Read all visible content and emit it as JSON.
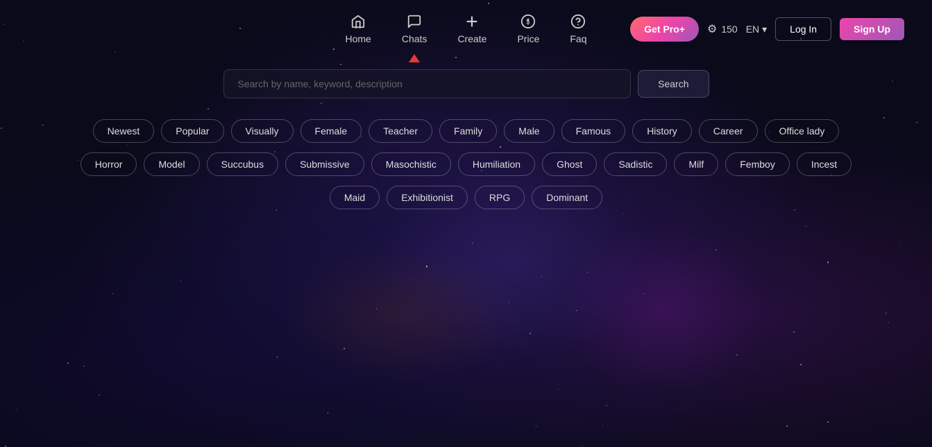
{
  "nav": {
    "items": [
      {
        "id": "home",
        "label": "Home",
        "icon": "⌂"
      },
      {
        "id": "chats",
        "label": "Chats",
        "icon": "💬",
        "active": true,
        "arrow": true
      },
      {
        "id": "create",
        "label": "Create",
        "icon": "+"
      },
      {
        "id": "price",
        "label": "Price",
        "icon": "💲"
      },
      {
        "id": "faq",
        "label": "Faq",
        "icon": "?"
      }
    ],
    "pro_label": "Get Pro+",
    "credits": "150",
    "lang": "EN",
    "login_label": "Log In",
    "signup_label": "Sign Up"
  },
  "search": {
    "placeholder": "Search by name, keyword, description",
    "button_label": "Search"
  },
  "tags": {
    "row1": [
      "Newest",
      "Popular",
      "Visually",
      "Female",
      "Teacher",
      "Family",
      "Male",
      "Famous",
      "History",
      "Career",
      "Office lady"
    ],
    "row2": [
      "Horror",
      "Model",
      "Succubus",
      "Submissive",
      "Masochistic",
      "Humiliation",
      "Ghost",
      "Sadistic",
      "Milf",
      "Femboy",
      "Incest"
    ],
    "row3": [
      "Maid",
      "Exhibitionist",
      "RPG",
      "Dominant"
    ]
  }
}
